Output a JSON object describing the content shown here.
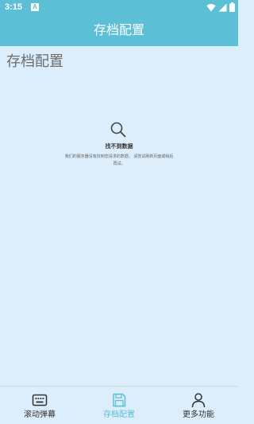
{
  "status_bar": {
    "time": "3:15",
    "notification_icon_letter": "A",
    "icons": [
      "wifi-icon",
      "signal-icon",
      "battery-icon"
    ]
  },
  "app_bar": {
    "title": "存档配置"
  },
  "page": {
    "heading": "存档配置"
  },
  "empty_state": {
    "icon": "search-icon",
    "title": "找不到数据",
    "description": "我们的服务器没有找到您请求的数据。 请尝试刷新页面或稍后再试。"
  },
  "bottom_nav": {
    "items": [
      {
        "label": "滚动弹幕",
        "icon": "keyboard-icon",
        "active": false
      },
      {
        "label": "存档配置",
        "icon": "save-icon",
        "active": true
      },
      {
        "label": "更多功能",
        "icon": "person-icon",
        "active": false
      }
    ]
  },
  "colors": {
    "primary": "#5dbfd6",
    "background": "#dceefc",
    "text": "#333333",
    "heading": "#6b6b6b"
  }
}
